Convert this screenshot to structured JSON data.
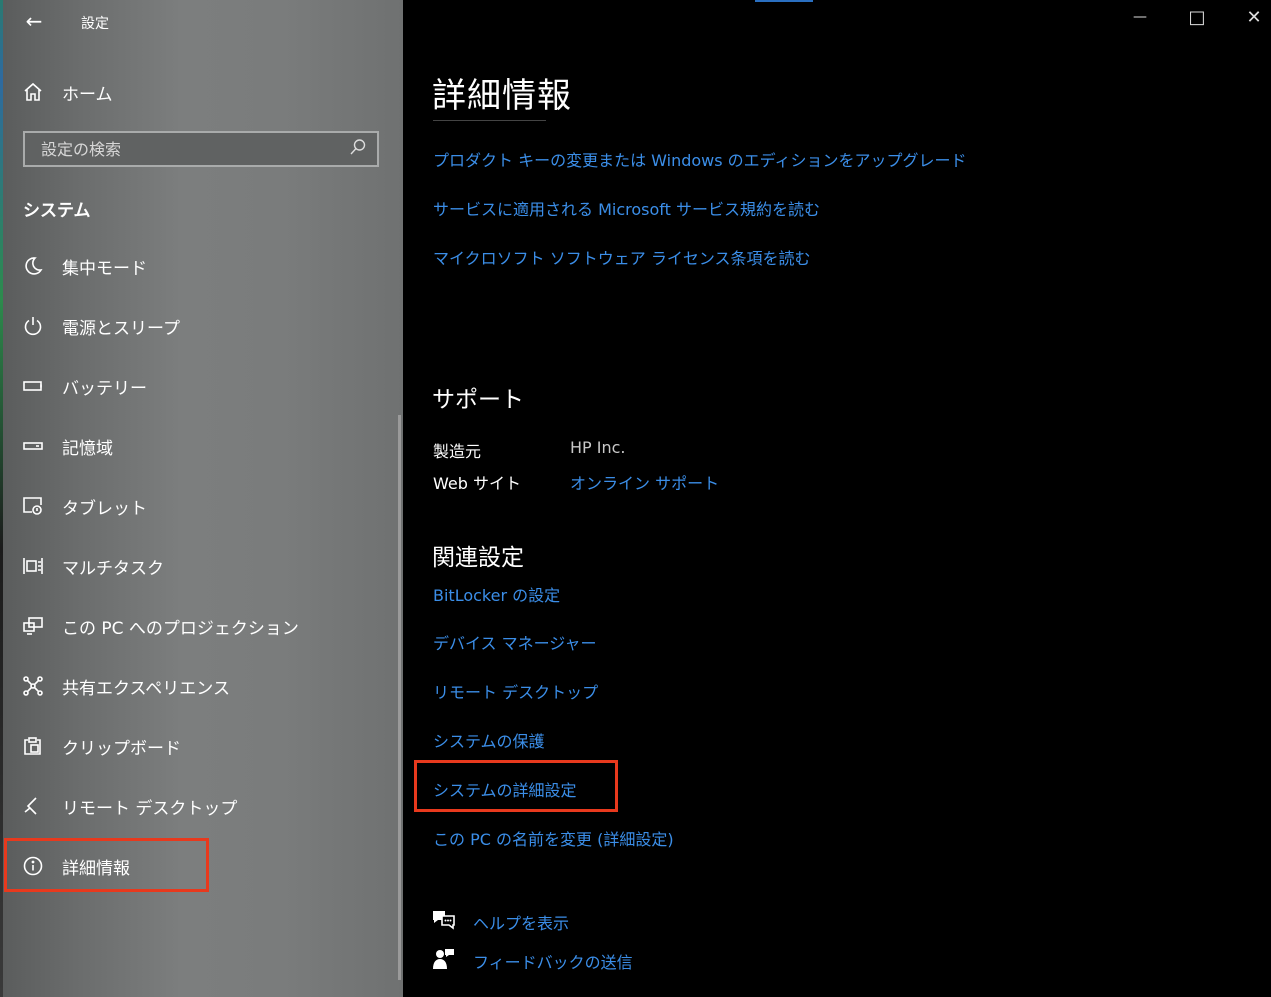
{
  "window": {
    "title": "設定",
    "back_glyph": "←",
    "minimize_glyph": "—",
    "maximize_glyph": "□",
    "close_glyph": "✕"
  },
  "sidebar": {
    "home_label": "ホーム",
    "search": {
      "placeholder": "設定の検索",
      "value": ""
    },
    "section_title": "システム",
    "items": [
      {
        "label": "集中モード",
        "icon": "moon-icon"
      },
      {
        "label": "電源とスリープ",
        "icon": "power-icon"
      },
      {
        "label": "バッテリー",
        "icon": "battery-icon"
      },
      {
        "label": "記憶域",
        "icon": "storage-icon"
      },
      {
        "label": "タブレット",
        "icon": "tablet-icon"
      },
      {
        "label": "マルチタスク",
        "icon": "multitask-icon"
      },
      {
        "label": "この PC へのプロジェクション",
        "icon": "projection-icon"
      },
      {
        "label": "共有エクスペリエンス",
        "icon": "shared-experience-icon"
      },
      {
        "label": "クリップボード",
        "icon": "clipboard-icon"
      },
      {
        "label": "リモート デスクトップ",
        "icon": "remote-desktop-icon"
      },
      {
        "label": "詳細情報",
        "icon": "info-icon"
      }
    ]
  },
  "main": {
    "title": "詳細情報",
    "top_links": [
      "プロダクト キーの変更または Windows のエディションをアップグレード",
      "サービスに適用される Microsoft サービス規約を読む",
      "マイクロソフト ソフトウェア ライセンス条項を読む"
    ],
    "support": {
      "title": "サポート",
      "rows": [
        {
          "label": "製造元",
          "value": "HP Inc.",
          "is_link": false
        },
        {
          "label": "Web サイト",
          "value": "オンライン サポート",
          "is_link": true
        }
      ]
    },
    "related": {
      "title": "関連設定",
      "links": [
        "BitLocker の設定",
        "デバイス マネージャー",
        "リモート デスクトップ",
        "システムの保護",
        "システムの詳細設定",
        "この PC の名前を変更 (詳細設定)"
      ]
    },
    "help": {
      "get_help": "ヘルプを表示",
      "feedback": "フィードバックの送信"
    }
  },
  "colors": {
    "link": "#3b8ee8",
    "highlight": "#e8391d",
    "accent": "#2a6fc0"
  }
}
